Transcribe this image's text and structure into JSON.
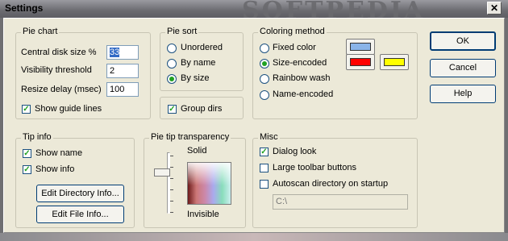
{
  "window": {
    "title": "Settings",
    "watermark": "SOFTPEDIA",
    "close_label": "✕"
  },
  "pie_chart": {
    "label": "Pie chart",
    "central_label": "Central disk size %",
    "central_value": "33",
    "visibility_label": "Visibility threshold",
    "visibility_value": "2",
    "resize_label": "Resize delay (msec)",
    "resize_value": "100",
    "guide_label": "Show guide lines",
    "guide_checked": true
  },
  "pie_sort": {
    "label": "Pie sort",
    "options": [
      "Unordered",
      "By name",
      "By size"
    ],
    "selected": "By size",
    "group_label": "Group dirs",
    "group_checked": true
  },
  "coloring": {
    "label": "Coloring method",
    "options": [
      "Fixed color",
      "Size-encoded",
      "Rainbow wash",
      "Name-encoded"
    ],
    "selected": "Size-encoded",
    "fixed_color": "#8ab4e8",
    "size_color_1": "#ff0000",
    "size_color_2": "#ffff00"
  },
  "buttons": {
    "ok": "OK",
    "cancel": "Cancel",
    "help": "Help"
  },
  "tip_info": {
    "label": "Tip info",
    "show_name": "Show name",
    "show_name_checked": true,
    "show_info": "Show info",
    "show_info_checked": true,
    "edit_dir": "Edit Directory Info...",
    "edit_file": "Edit File Info..."
  },
  "transparency": {
    "label": "Pie tip transparency",
    "solid": "Solid",
    "invisible": "Invisible",
    "slider_level": 0.3
  },
  "misc": {
    "label": "Misc",
    "dialog_look": "Dialog look",
    "dialog_look_checked": true,
    "large_toolbar": "Large toolbar buttons",
    "large_toolbar_checked": false,
    "autoscan": "Autoscan directory on startup",
    "autoscan_checked": false,
    "path_value": "C:\\"
  }
}
